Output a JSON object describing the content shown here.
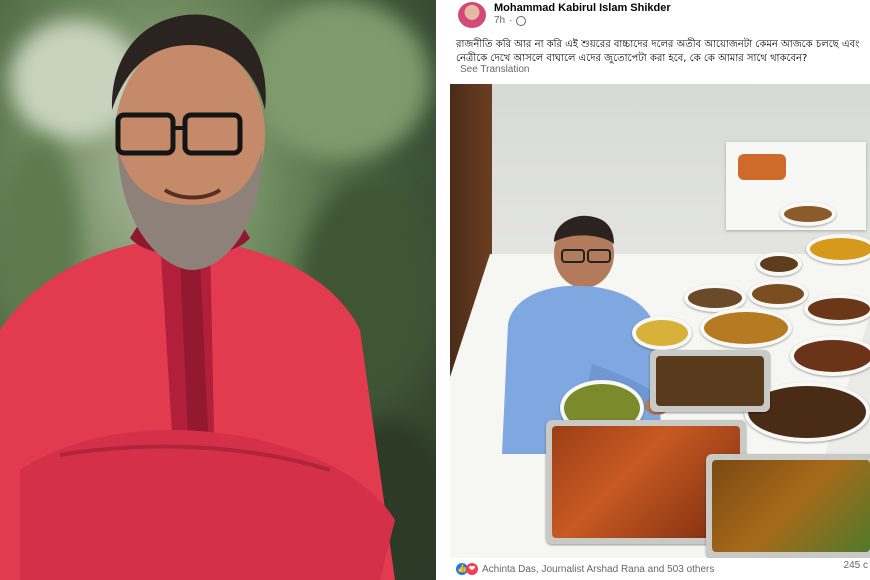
{
  "post": {
    "author": "Mohammad Kabirul Islam Shikder",
    "time": "7h",
    "text_line1": "রাজনীতি করি আর না করি এই শুয়রের বাচ্চাদের দলের অতীব আয়োজনটা কেমন আজকে চলছে এবং",
    "text_line2": "নেত্রীকে দেখে আসলে বাঘালে এদের জুতোপেটা করা হবে, কে কে আমার সাথে থাকবেন?",
    "see_translation": "See Translation",
    "reactions_text": "Achinta Das, Journalist Arshad Rana and 503 others",
    "comments_count": "245 c"
  },
  "icons": {
    "like": "like-icon",
    "love": "heart-icon",
    "globe": "globe-icon"
  },
  "colors": {
    "kurta": "#e23a4f",
    "like_blue": "#1877f2",
    "love_red": "#f33e58"
  }
}
